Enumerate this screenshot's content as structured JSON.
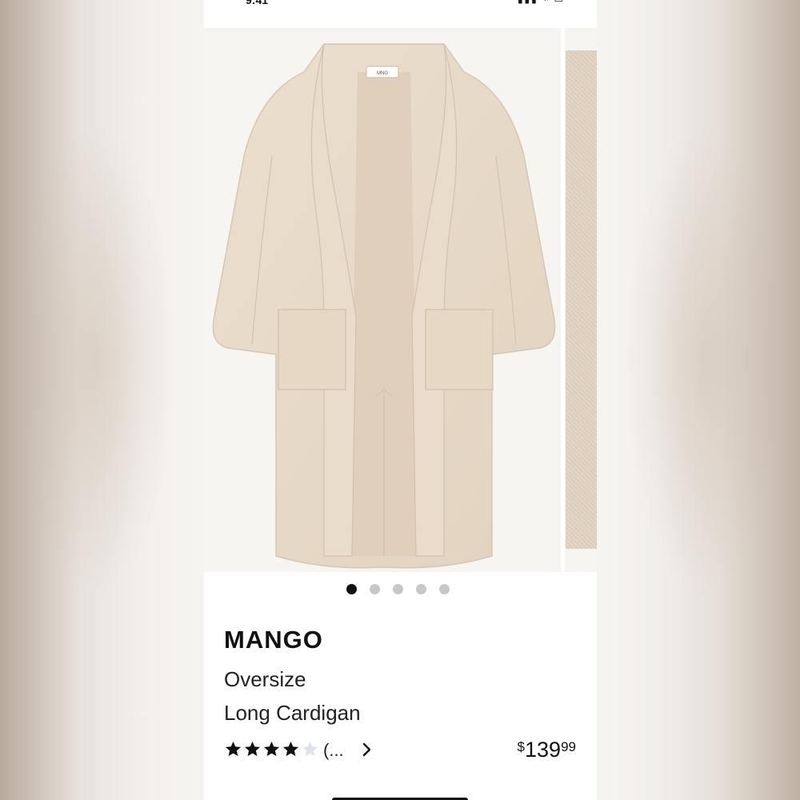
{
  "status_bar": {
    "time": "9:41",
    "icons": "▮▮▮ ⌁ ▭"
  },
  "product": {
    "brand": "MANGO",
    "name_line1": "Oversize",
    "name_line2": "Long Cardigan",
    "rating": 4,
    "rating_max": 5,
    "review_count_text": "(...",
    "price_currency": "$",
    "price_dollars": "139",
    "price_cents": "99",
    "image_label": "MNG"
  },
  "carousel": {
    "total": 5,
    "active_index": 0
  },
  "colors": {
    "garment": "#e7d9c7",
    "accent": "#111111",
    "dot_inactive": "#c7c7c7",
    "star_empty": "#dde3ea"
  },
  "icons": {
    "next_chevron": "chevron-right-icon",
    "star": "star-icon"
  }
}
